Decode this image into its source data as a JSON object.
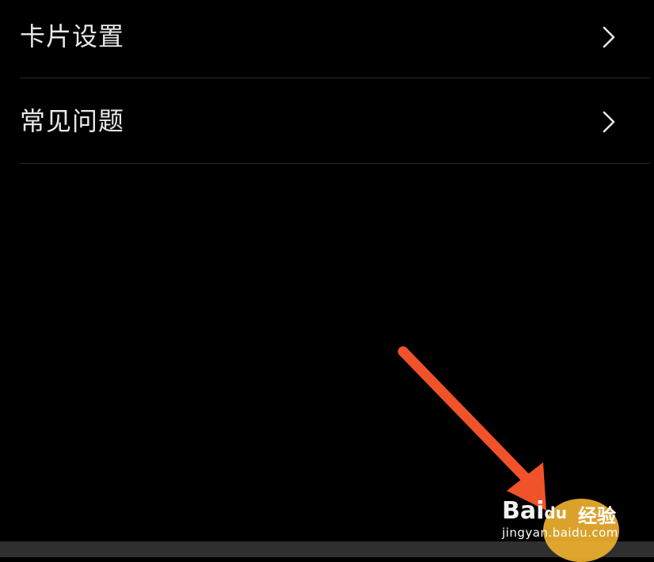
{
  "menu": {
    "items": [
      {
        "label": "卡片设置",
        "icon": "chevron-right-icon"
      },
      {
        "label": "常见问题",
        "icon": "chevron-right-icon"
      }
    ]
  },
  "annotation": {
    "arrow_color": "#f0522a",
    "icon": "arrow-annotation"
  },
  "watermark": {
    "brand": "Bai",
    "brand_suffix": "du",
    "product": "经验",
    "url": "jingyan.baidu.com"
  },
  "colors": {
    "background": "#000000",
    "text": "#e8e8e8",
    "divider": "#2a2a2a",
    "bottom_bar": "#2f2f2f"
  }
}
